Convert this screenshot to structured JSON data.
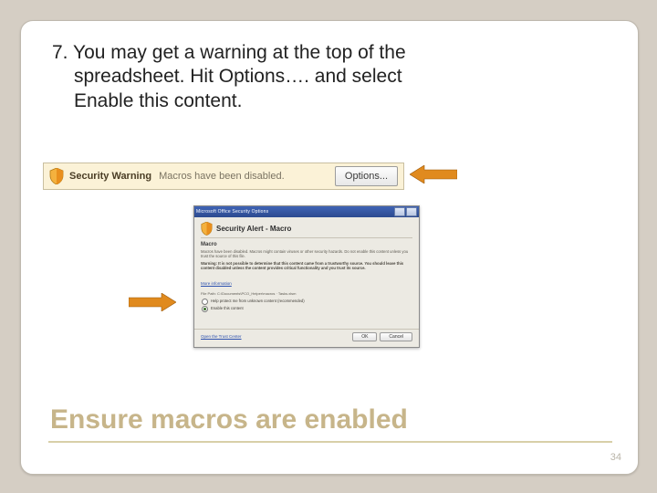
{
  "step": {
    "number": "7.",
    "line1": "You may get a warning at the top of the",
    "line2": "spreadsheet.  Hit Options…. and select",
    "line3": "Enable this content."
  },
  "securityBar": {
    "title": "Security Warning",
    "message": "Macros have been disabled.",
    "button": "Options..."
  },
  "dialog": {
    "windowTitle": "Microsoft Office Security Options",
    "headTitle": "Security Alert - Macro",
    "subhead": "Macro",
    "para1": "Macros have been disabled. Macros might contain viruses or other security hazards. Do not enable this content unless you trust the source of this file.",
    "warnBold": "Warning: It is not possible to determine that this content came from a trustworthy source. You should leave this content disabled unless the content provides critical functionality and you trust its source.",
    "moreInfo": "More information",
    "pathLabel": "File Path:",
    "pathValue": "C:\\Documents\\PCO_Helper\\macros · Tasks.xlsm",
    "opt1": "Help protect me from unknown content (recommended)",
    "opt2": "Enable this content",
    "trustLink": "Open the Trust Center",
    "ok": "OK",
    "cancel": "Cancel"
  },
  "footerTitle": "Ensure macros are enabled",
  "pageNumber": "34"
}
